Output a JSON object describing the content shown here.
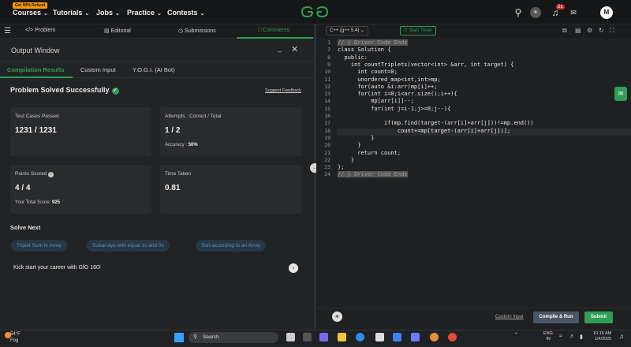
{
  "topnav": {
    "promo": "Get 90% Refund",
    "items": [
      "Courses",
      "Tutorials",
      "Jobs",
      "Practice",
      "Contests"
    ],
    "logo": "GG",
    "notification_count": "51",
    "avatar_initial": "M"
  },
  "problem_tabs": [
    "Problem",
    "Editorial",
    "Submissions",
    "Comments"
  ],
  "output": {
    "title": "Output Window",
    "subtabs": [
      "Compilation Results",
      "Custom Input",
      "Y.O.G.I. (AI Bot)"
    ],
    "status": "Problem Solved Successfully",
    "feedback": "Suggest Feedback",
    "cards": {
      "tests_label": "Test Cases Passed",
      "tests_value": "1231 / 1231",
      "attempts_label": "Attempts : Correct / Total",
      "attempts_value": "1 / 2",
      "accuracy_label": "Accuracy :",
      "accuracy_value": "50%",
      "points_label": "Points Scored",
      "points_value": "4 / 4",
      "total_label": "Your Total Score:",
      "total_value": "925",
      "time_label": "Time Taken",
      "time_value": "0.81"
    },
    "solve_next": "Solve Next",
    "suggestions": [
      "Triplet Sum in Array",
      "Subarrays with equal 1s and 0s",
      "Sort according to an Array"
    ],
    "kickstart": "Kick start your career with GfG 160!"
  },
  "editor": {
    "language": "C++ (g++ 5.4)",
    "timer": "Start Timer",
    "lines": [
      {
        "n": "1",
        "t": "// } Driver Code Ends"
      },
      {
        "n": "7",
        "t": "class Solution {"
      },
      {
        "n": "8",
        "t": "  public:"
      },
      {
        "n": "9",
        "t": "    int countTriplets(vector<int> &arr, int target) {"
      },
      {
        "n": "10",
        "t": "      int count=0;"
      },
      {
        "n": "11",
        "t": "      unordered_map<int,int>mp;"
      },
      {
        "n": "12",
        "t": "      for(auto &i:arr)mp[i]++;"
      },
      {
        "n": "13",
        "t": "      for(int i=0;i<arr.size();i++){"
      },
      {
        "n": "14",
        "t": "          mp[arr[i]]--;"
      },
      {
        "n": "15",
        "t": "          for(int j=i-1;j>=0;j--){"
      },
      {
        "n": "16",
        "t": ""
      },
      {
        "n": "17",
        "t": "              if(mp.find(target-(arr[i]+arr[j]))!=mp.end())"
      },
      {
        "n": "18",
        "t": "                  count+=mp[target-(arr[i]+arr[j])];"
      },
      {
        "n": "19",
        "t": "          }"
      },
      {
        "n": "20",
        "t": "      }"
      },
      {
        "n": "21",
        "t": "      return count;"
      },
      {
        "n": "22",
        "t": "    }"
      },
      {
        "n": "23",
        "t": "};"
      },
      {
        "n": "24",
        "t": "// } Driver Code Ends"
      }
    ],
    "custom_input": "Custom Input",
    "compile": "Compile & Run",
    "submit": "Submit"
  },
  "taskbar": {
    "temp": "54°F",
    "weather": "Fog",
    "search": "Search",
    "lang1": "ENG",
    "lang2": "IN",
    "time": "10:16 AM",
    "date": "1/4/2025"
  },
  "colors": {
    "accent": "#2f9e56",
    "chip": "#5a8fc0"
  }
}
